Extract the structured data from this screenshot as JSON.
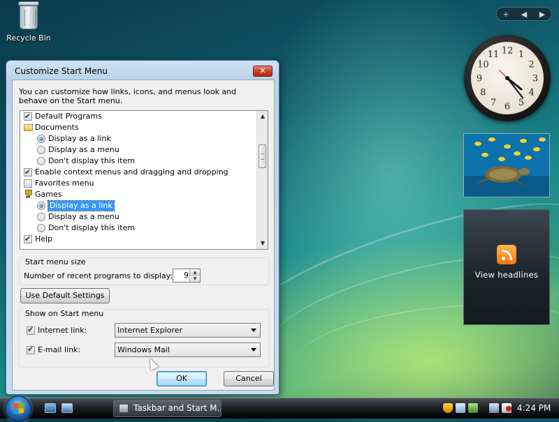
{
  "desktop": {
    "recycle_bin_label": "Recycle Bin"
  },
  "sidebar": {
    "add_label": "+",
    "prev_label": "◀",
    "next_label": "▶",
    "clock_numbers": [
      "12",
      "1",
      "2",
      "3",
      "4",
      "5",
      "6",
      "7",
      "8",
      "9",
      "10",
      "11"
    ],
    "feed_label": "View headlines"
  },
  "dialog": {
    "title": "Customize Start Menu",
    "close_label": "✕",
    "intro": "You can customize how links, icons, and menus look and behave on the Start menu.",
    "list_items": [
      {
        "label": "Default Programs",
        "type": "checkbox",
        "checked": true,
        "indent": 0
      },
      {
        "label": "Documents",
        "type": "folder",
        "indent": 0
      },
      {
        "label": "Display as a link",
        "type": "radio",
        "checked": true,
        "indent": 1
      },
      {
        "label": "Display as a menu",
        "type": "radio",
        "checked": false,
        "indent": 1
      },
      {
        "label": "Don't display this item",
        "type": "radio",
        "checked": false,
        "indent": 1
      },
      {
        "label": "Enable context menus and dragging and dropping",
        "type": "checkbox",
        "checked": true,
        "indent": 0
      },
      {
        "label": "Favorites menu",
        "type": "checkbox",
        "checked": false,
        "indent": 0
      },
      {
        "label": "Games",
        "type": "trophy",
        "indent": 0
      },
      {
        "label": "Display as a link",
        "type": "radio",
        "checked": true,
        "indent": 1,
        "selected": true
      },
      {
        "label": "Display as a menu",
        "type": "radio",
        "checked": false,
        "indent": 1
      },
      {
        "label": "Don't display this item",
        "type": "radio",
        "checked": false,
        "indent": 1
      },
      {
        "label": "Help",
        "type": "checkbox",
        "checked": true,
        "indent": 0
      }
    ],
    "start_menu_size": {
      "group_title": "Start menu size",
      "recent_label": "Number of recent programs to display:",
      "recent_value": "9"
    },
    "use_default_label": "Use Default Settings",
    "show_on_start": {
      "group_title": "Show on Start menu",
      "internet_label": "Internet link:",
      "internet_checked": true,
      "internet_value": "Internet Explorer",
      "email_label": "E-mail link:",
      "email_checked": true,
      "email_value": "Windows Mail"
    },
    "ok_label": "OK",
    "cancel_label": "Cancel"
  },
  "taskbar": {
    "task_label": "Taskbar and Start M...",
    "time": "4:24 PM"
  }
}
